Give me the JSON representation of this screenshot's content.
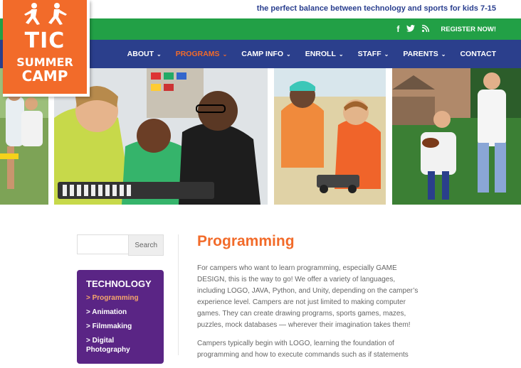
{
  "header": {
    "tagline": "the perfect balance between technology and sports for kids 7-15",
    "register": "REGISTER NOW!"
  },
  "social": [
    {
      "icon": "facebook-icon",
      "glyph": "f"
    },
    {
      "icon": "twitter-icon",
      "glyph": "🐦"
    },
    {
      "icon": "rss-icon",
      "glyph": "⌘"
    }
  ],
  "nav": [
    {
      "label": "ABOUT",
      "active": false
    },
    {
      "label": "PROGRAMS",
      "active": true
    },
    {
      "label": "CAMP INFO",
      "active": false
    },
    {
      "label": "ENROLL",
      "active": false
    },
    {
      "label": "STAFF",
      "active": false
    },
    {
      "label": "PARENTS",
      "active": false
    },
    {
      "label": "CONTACT",
      "active": false
    }
  ],
  "logo": {
    "tic": "TIC",
    "summer": "SUMMER",
    "camp": "CAMP"
  },
  "colors": {
    "orange": "#f26b2a",
    "green": "#22a046",
    "navy": "#2b3f8c",
    "purple": "#5a2585"
  },
  "search": {
    "button": "Search",
    "placeholder": ""
  },
  "sidebar": {
    "title": "TECHNOLOGY",
    "links": [
      {
        "label": "> Programming",
        "active": true
      },
      {
        "label": "> Animation",
        "active": false
      },
      {
        "label": "> Filmmaking",
        "active": false
      },
      {
        "label": "> Digital Photography",
        "active": false
      }
    ]
  },
  "content": {
    "title": "Programming",
    "paragraphs": [
      "For campers who want to learn programming, especially GAME DESIGN, this is the way to go! We offer a variety of languages, including LOGO, JAVA, Python, and Unity, depending on the camper’s experience level. Campers are not just limited to making computer games. They can create drawing programs, sports games, mazes, puzzles, mock databases — wherever their imagination takes them!",
      "Campers typically begin with LOGO, learning the foundation of programming and how to execute commands such as if statements"
    ]
  }
}
